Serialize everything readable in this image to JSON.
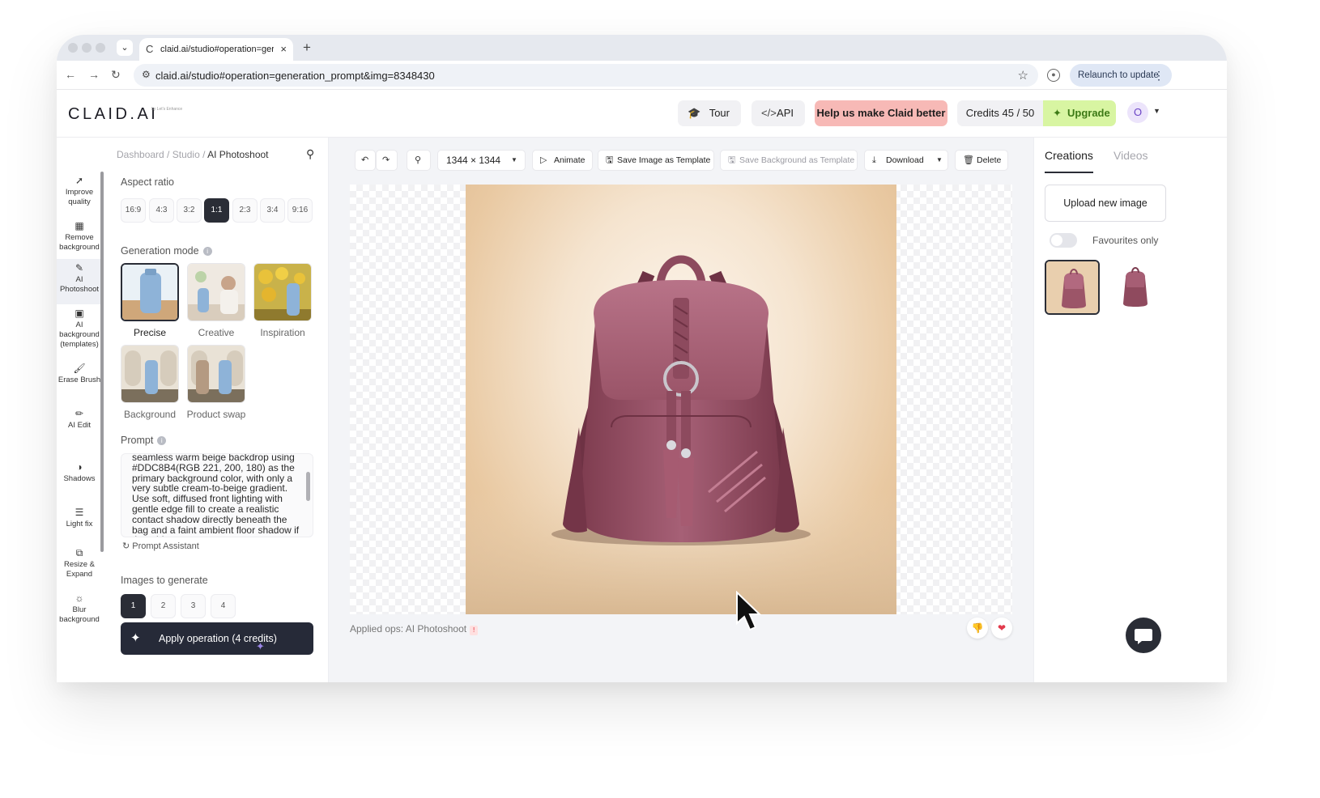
{
  "browser": {
    "tab_title": "claid.ai/studio#operation=ger",
    "url": "claid.ai/studio#operation=generation_prompt&img=8348430",
    "relaunch_label": "Relaunch to update",
    "icons": [
      "back-arrow-icon",
      "forward-arrow-icon",
      "reload-icon",
      "site-info-icon",
      "star-icon",
      "profile-icon",
      "menu-dots-icon"
    ]
  },
  "header": {
    "logo": "CLAID.AI",
    "logo_sub": "by Let's Enhance",
    "tour_label": "Tour",
    "api_label": "API",
    "help_label": "Help us make Claid better",
    "credits_label": "Credits 45 / 50",
    "upgrade_label": "Upgrade",
    "avatar_initial": "O",
    "colors": {
      "help": "#f7b9b6",
      "upgrade_bg": "#d8f5a2",
      "upgrade_text": "#3d7a16"
    }
  },
  "rail": {
    "items": [
      {
        "label": "Improve quality",
        "icon": "wand-icon"
      },
      {
        "label": "Remove background",
        "icon": "checker-icon"
      },
      {
        "label": "AI Photoshoot",
        "icon": "pen-icon"
      },
      {
        "label": "AI background (templates)",
        "icon": "image-icon"
      },
      {
        "label": "Erase Brush",
        "icon": "brush-icon"
      },
      {
        "label": "AI Edit",
        "icon": "edit-icon"
      },
      {
        "label": "Shadows",
        "icon": "shadow-icon"
      },
      {
        "label": "Light fix",
        "icon": "sliders-icon"
      },
      {
        "label": "Resize & Expand",
        "icon": "crop-icon"
      },
      {
        "label": "Blur background",
        "icon": "blur-icon"
      }
    ]
  },
  "panel": {
    "breadcrumb": {
      "dashboard": "Dashboard",
      "studio": "Studio",
      "current": "AI Photoshoot"
    },
    "aspect_ratio_title": "Aspect ratio",
    "aspect_ratios": [
      "16:9",
      "4:3",
      "3:2",
      "1:1",
      "2:3",
      "3:4",
      "9:16"
    ],
    "aspect_selected": "1:1",
    "generation_mode_title": "Generation mode",
    "modes": [
      "Precise",
      "Creative",
      "Inspiration",
      "Background",
      "Product swap"
    ],
    "mode_selected": "Precise",
    "prompt_title": "Prompt",
    "prompt_text": "seamless warm beige backdrop using #DDC8B4(RGB 221, 200, 180) as the primary background color, with only a very subtle cream-to-beige gradient. Use soft, diffused front lighting with gentle edge fill to create a realistic contact shadow directly beneath the bag and a faint ambient floor shadow if the table...",
    "prompt_assistant": "Prompt Assistant",
    "images_title": "Images to generate",
    "image_counts": [
      "1",
      "2",
      "3",
      "4"
    ],
    "image_count_selected": "1",
    "apply_label": "Apply operation (4 credits)"
  },
  "toolbar": {
    "size_label": "1344 × 1344",
    "animate_label": "Animate",
    "save_template_label": "Save Image as Template",
    "save_bg_label": "Save Background as Template",
    "download_label": "Download",
    "delete_label": "Delete"
  },
  "canvas": {
    "applied_ops": "Applied ops: AI Photoshoot",
    "background_color": "#DDC8B4",
    "bag_color": "#9c5568"
  },
  "right": {
    "tab_creations": "Creations",
    "tab_videos": "Videos",
    "upload_label": "Upload new image",
    "favourites_label": "Favourites only",
    "favourites_on": false
  }
}
